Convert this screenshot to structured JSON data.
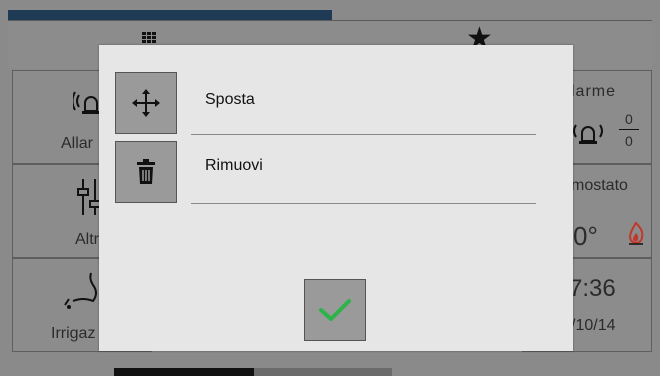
{
  "background": {
    "tiles": {
      "alarms_left": "Allar",
      "other_left": "Altr",
      "irrigation_left": "Irrigaz",
      "alarms_right": "larme",
      "alarms_count_top": "0",
      "alarms_count_bottom": "0",
      "thermostat_right": "mostato",
      "temperature": "0°",
      "clock_time": "7:36",
      "clock_date": "/10/14"
    }
  },
  "modal": {
    "items": [
      {
        "label": "Sposta",
        "icon": "move-icon"
      },
      {
        "label": "Rimuovi",
        "icon": "trash-icon"
      }
    ],
    "confirm_icon": "checkmark-icon"
  },
  "colors": {
    "modal_bg": "#e6e6e6",
    "button_bg": "#9a9a9a",
    "check_green": "#2db34a",
    "flame_red": "#c0392b"
  }
}
